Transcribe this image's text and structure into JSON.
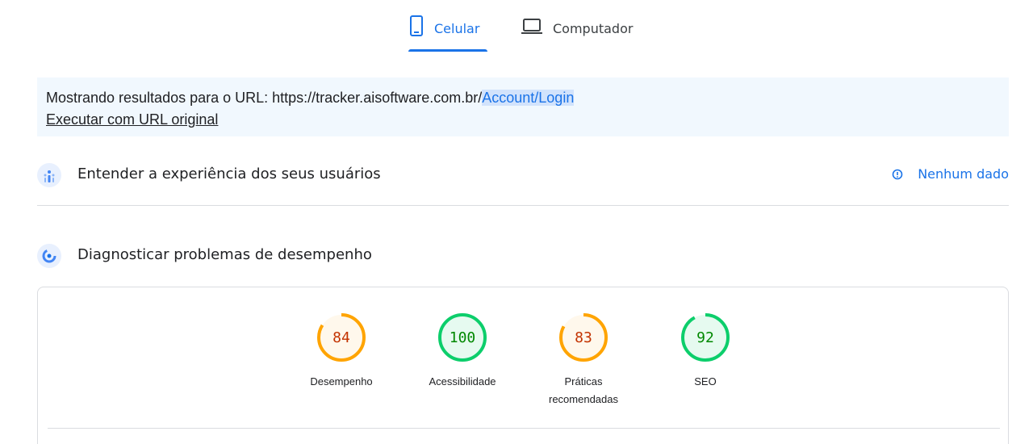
{
  "tabs": {
    "celular": "Celular",
    "computador": "Computador"
  },
  "banner": {
    "prefix": "Mostrando resultados para o URL: https://tracker.aisoftware.com.br/",
    "highlight": "Account/Login",
    "link": "Executar com URL original"
  },
  "sections": {
    "experience_title": "Entender a experiência dos seus usuários",
    "no_data": "Nenhum dado",
    "diagnose_title": "Diagnosticar problemas de desempenho"
  },
  "scores": [
    {
      "name": "desempenho",
      "value": 84,
      "label": "Desempenho",
      "status": "average"
    },
    {
      "name": "acessibilidade",
      "value": 100,
      "label": "Acessibilidade",
      "status": "pass"
    },
    {
      "name": "praticas-recomendadas",
      "value": 83,
      "label": "Práticas recomendadas",
      "status": "average"
    },
    {
      "name": "seo",
      "value": 92,
      "label": "SEO",
      "status": "pass"
    }
  ],
  "colors": {
    "accent": "#1a73e8",
    "average_stroke": "#ffa400",
    "average_fill": "#fff8ec",
    "average_text": "#c33300",
    "pass_stroke": "#0cce6b",
    "pass_fill": "#e6faf0",
    "pass_text": "#008800"
  }
}
